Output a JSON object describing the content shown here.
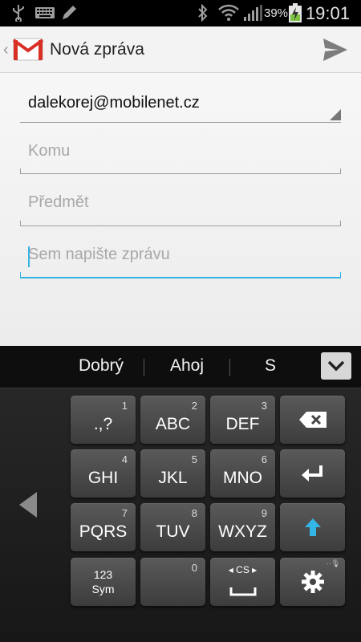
{
  "status_bar": {
    "battery_percent": "39%",
    "time": "19:01",
    "icons": [
      "usb-icon",
      "keyboard-icon",
      "pen-icon",
      "bluetooth-icon",
      "wifi-icon",
      "signal-icon",
      "battery-charging-icon"
    ]
  },
  "action_bar": {
    "title": "Nová zpráva",
    "icons": [
      "back-caret-icon",
      "gmail-icon",
      "send-icon"
    ]
  },
  "compose": {
    "from_value": "dalekorej@mobilenet.cz",
    "to_placeholder": "Komu",
    "subject_placeholder": "Předmět",
    "body_placeholder": "Sem napište zprávu"
  },
  "keyboard": {
    "suggestions": [
      "Dobrý",
      "Ahoj",
      "S"
    ],
    "keys": {
      "k1": {
        "main": ".,?",
        "num": "1"
      },
      "k2": {
        "main": "ABC",
        "num": "2"
      },
      "k3": {
        "main": "DEF",
        "num": "3"
      },
      "k4": {
        "main": "GHI",
        "num": "4"
      },
      "k5": {
        "main": "JKL",
        "num": "5"
      },
      "k6": {
        "main": "MNO",
        "num": "6"
      },
      "k7": {
        "main": "PQRS",
        "num": "7"
      },
      "k8": {
        "main": "TUV",
        "num": "8"
      },
      "k9": {
        "main": "WXYZ",
        "num": "9"
      },
      "k0": {
        "num": "0"
      },
      "sym_top": "123",
      "sym_bottom": "Sym",
      "space_lang": "CS"
    },
    "accent_color": "#33b5e5"
  }
}
